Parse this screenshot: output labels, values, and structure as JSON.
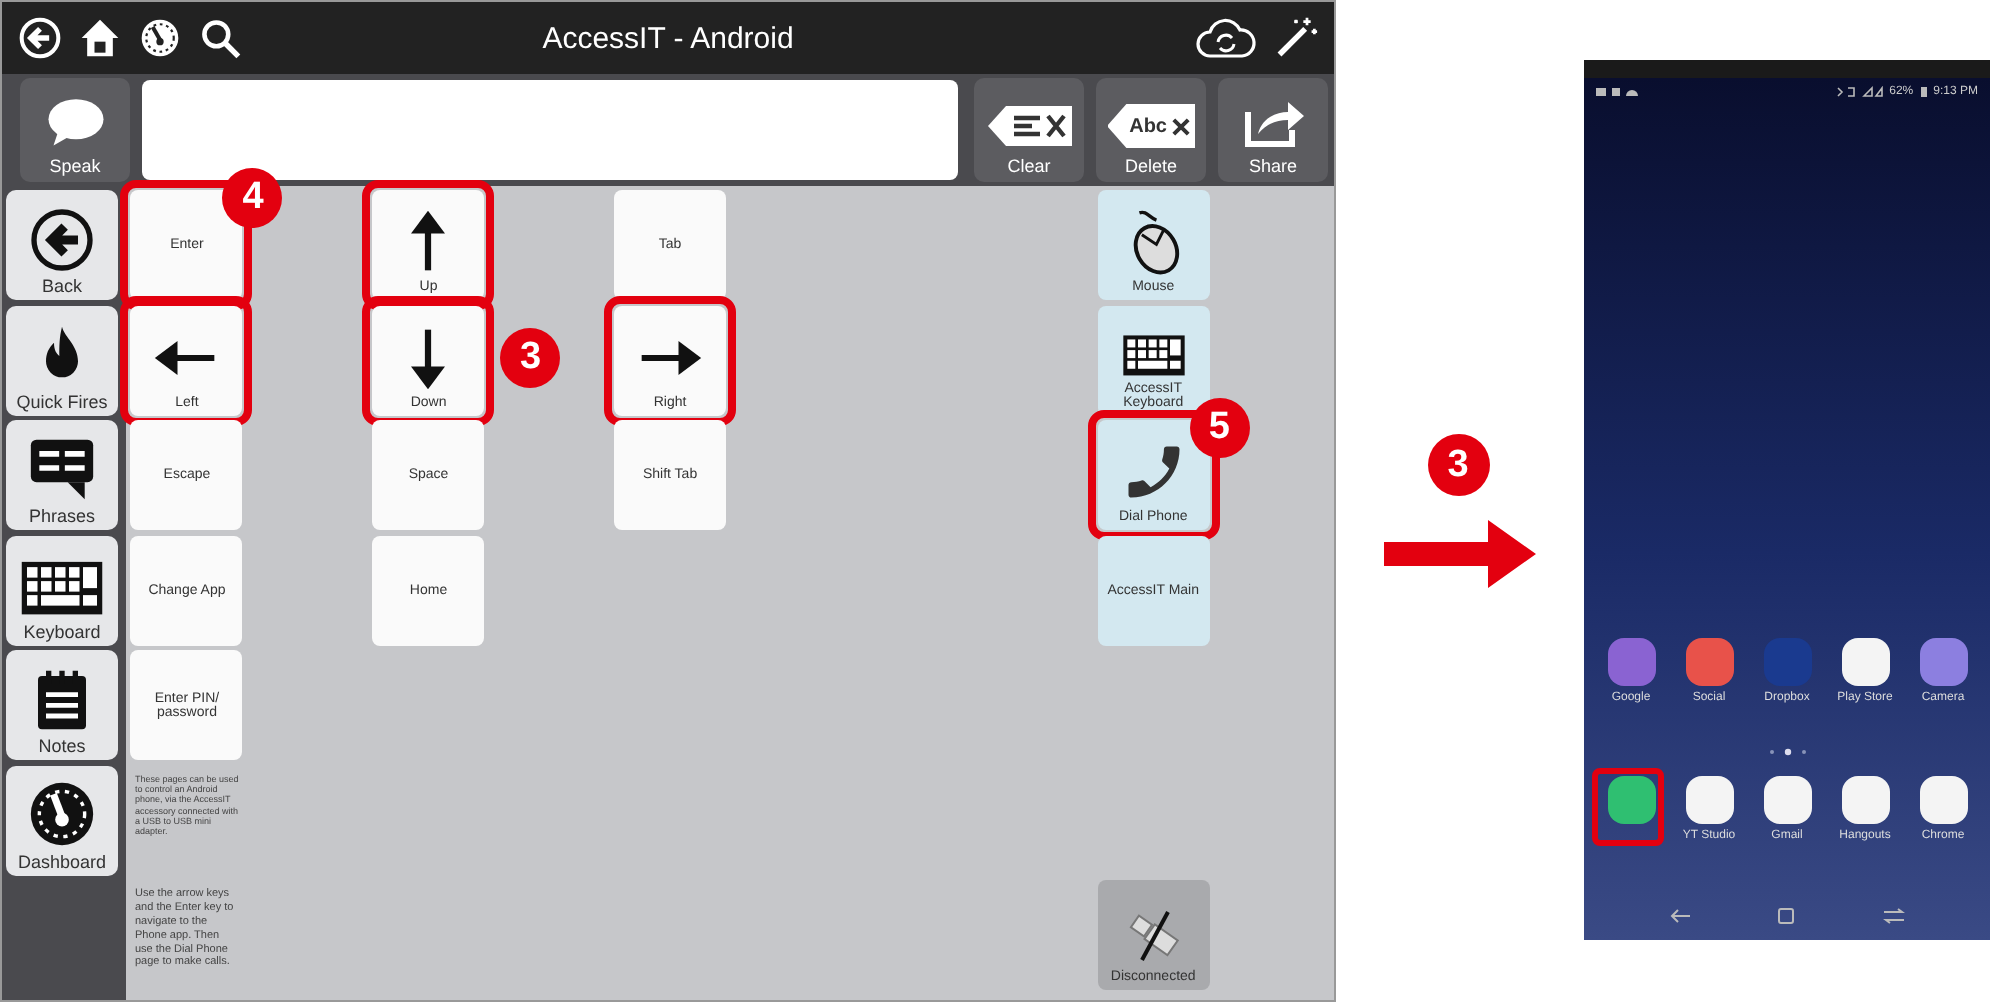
{
  "window": {
    "title": "AccessIT - Android"
  },
  "message_bar": {
    "speak": {
      "label": "Speak"
    },
    "buttons": [
      {
        "kind": "clear",
        "label": "Clear"
      },
      {
        "kind": "delete",
        "label": "Delete",
        "icon_text": "Abc"
      },
      {
        "kind": "share",
        "label": "Share"
      }
    ]
  },
  "sidebar": {
    "items": [
      {
        "kind": "back",
        "label": "Back"
      },
      {
        "kind": "fire",
        "label": "Quick Fires"
      },
      {
        "kind": "phrases",
        "label": "Phrases"
      },
      {
        "kind": "keyboard",
        "label": "Keyboard"
      },
      {
        "kind": "notes",
        "label": "Notes"
      },
      {
        "kind": "dashboard",
        "label": "Dashboard"
      }
    ]
  },
  "grid": {
    "columns": [
      [
        {
          "kind": "key",
          "label": "Enter",
          "highlighted": true,
          "badge": "4"
        },
        {
          "kind": "arrow_left",
          "label": "Left",
          "highlighted": true
        },
        {
          "kind": "key",
          "label": "Escape",
          "highlighted": false
        },
        {
          "kind": "key",
          "label": "Change App",
          "highlighted": false
        },
        {
          "kind": "key",
          "label": "Enter PIN/ password",
          "highlighted": false
        },
        {
          "kind": "note",
          "label": "These pages can be used to control an Android phone, via the AccessIT accessory connected with a USB to USB mini adapter."
        },
        {
          "kind": "note",
          "label": "Use the arrow keys and the Enter key to navigate to the Phone app. Then use the Dial Phone page to make calls."
        }
      ],
      [
        {
          "kind": "arrow_up",
          "label": "Up",
          "highlighted": true
        },
        {
          "kind": "arrow_down",
          "label": "Down",
          "highlighted": true,
          "badge": "3"
        },
        {
          "kind": "key",
          "label": "Space",
          "highlighted": false
        },
        {
          "kind": "key",
          "label": "Home",
          "highlighted": false
        }
      ],
      [
        {
          "kind": "key",
          "label": "Tab",
          "highlighted": false
        },
        {
          "kind": "arrow_right",
          "label": "Right",
          "highlighted": true
        },
        {
          "kind": "key",
          "label": "Shift Tab",
          "highlighted": false
        }
      ],
      [
        {
          "kind": "mouse",
          "label": "Mouse",
          "highlighted": false
        },
        {
          "kind": "keyboard",
          "label": "AccessIT Keyboard",
          "highlighted": false
        },
        {
          "kind": "phone",
          "label": "Dial Phone",
          "highlighted": true,
          "badge": "5"
        },
        {
          "kind": "link",
          "label": "AccessIT Main",
          "highlighted": false
        }
      ]
    ],
    "status": {
      "label": "Disconnected"
    }
  },
  "step": {
    "badge": "3"
  },
  "phone": {
    "status_bar": {
      "battery": "62%",
      "time": "9:13 PM"
    },
    "apps": [
      {
        "label": "Google",
        "color": "#8a63d2",
        "highlighted": false
      },
      {
        "label": "Social",
        "color": "#e8524a",
        "highlighted": false
      },
      {
        "label": "Dropbox",
        "color": "#1a3a8f",
        "highlighted": false
      },
      {
        "label": "Play Store",
        "color": "#f4f4f4",
        "highlighted": false
      },
      {
        "label": "Camera",
        "color": "#8c7fe0",
        "highlighted": false
      }
    ],
    "dock": [
      {
        "color": "#2fbf71",
        "highlighted": true
      },
      {
        "label": "YT Studio",
        "color": "#f4f4f4",
        "highlighted": false
      },
      {
        "label": "Gmail",
        "color": "#f4f4f4",
        "highlighted": false
      },
      {
        "label": "Hangouts",
        "color": "#f4f4f4",
        "highlighted": false
      },
      {
        "label": "Chrome",
        "color": "#f4f4f4",
        "highlighted": false
      }
    ]
  }
}
